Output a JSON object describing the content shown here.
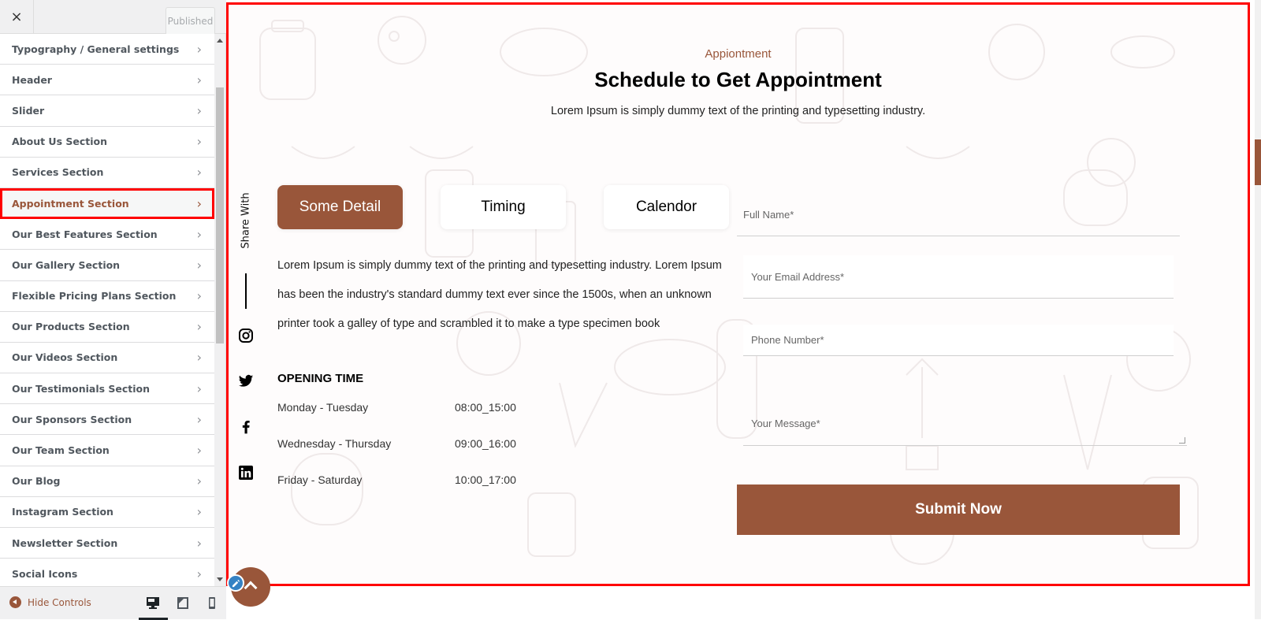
{
  "customizer": {
    "close_label": "×",
    "status_label": "Published",
    "menu_items": [
      {
        "label": "Typography / General settings"
      },
      {
        "label": "Header"
      },
      {
        "label": "Slider"
      },
      {
        "label": "About Us Section"
      },
      {
        "label": "Services Section"
      },
      {
        "label": "Appointment Section",
        "active": true
      },
      {
        "label": "Our Best Features Section"
      },
      {
        "label": "Our Gallery Section"
      },
      {
        "label": "Flexible Pricing Plans Section"
      },
      {
        "label": "Our Products Section"
      },
      {
        "label": "Our Videos Section"
      },
      {
        "label": "Our Testimonials Section"
      },
      {
        "label": "Our Sponsors Section"
      },
      {
        "label": "Our Team Section"
      },
      {
        "label": "Our Blog"
      },
      {
        "label": "Instagram Section"
      },
      {
        "label": "Newsletter Section"
      },
      {
        "label": "Social Icons"
      }
    ],
    "chevron_glyph": "›",
    "footer": {
      "hide_controls_label": "Hide Controls",
      "devices": [
        "desktop-icon",
        "tablet-icon",
        "mobile-icon"
      ],
      "active_device": "desktop"
    }
  },
  "preview": {
    "eyebrow": "Appiontment",
    "title": "Schedule to Get Appointment",
    "subtitle": "Lorem Ipsum is simply dummy text of the printing and typesetting industry.",
    "share_label": "Share With",
    "social_icons": [
      "instagram-icon",
      "twitter-icon",
      "facebook-icon",
      "linkedin-icon"
    ],
    "tabs": [
      {
        "label": "Some Detail",
        "active": true
      },
      {
        "label": "Timing"
      },
      {
        "label": "Calendor"
      }
    ],
    "detail_text": "Lorem Ipsum is simply dummy text of the printing and typesetting industry. Lorem Ipsum has been the industry's standard dummy text ever since the 1500s, when an unknown printer took a galley of type and scrambled it to make a type specimen book",
    "opening_time": {
      "title": "OPENING TIME",
      "rows": [
        {
          "days": "Monday - Tuesday",
          "hours": "08:00_15:00"
        },
        {
          "days": "Wednesday - Thursday",
          "hours": "09:00_16:00"
        },
        {
          "days": "Friday - Saturday",
          "hours": "10:00_17:00"
        }
      ]
    },
    "form": {
      "full_name_placeholder": "Full Name*",
      "email_placeholder": "Your Email Address*",
      "phone_placeholder": "Phone Number*",
      "message_placeholder": "Your Message*",
      "submit_label": "Submit Now"
    },
    "accent_color": "#99563a"
  }
}
